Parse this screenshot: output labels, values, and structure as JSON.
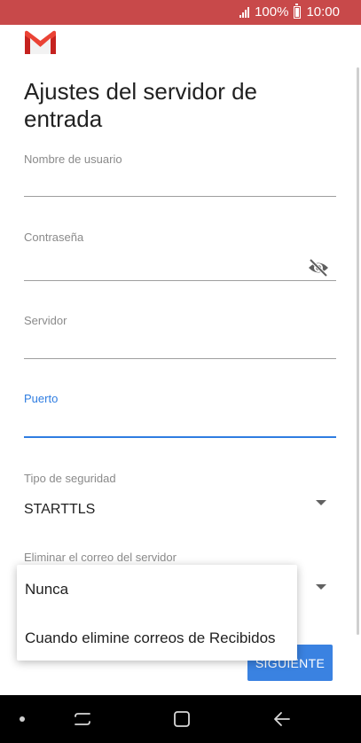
{
  "status_bar": {
    "battery": "100%",
    "time": "10:00"
  },
  "app": {
    "logo": "gmail-logo",
    "title": "Ajustes del servidor de entrada"
  },
  "form": {
    "username": {
      "label": "Nombre de usuario",
      "value": ""
    },
    "password": {
      "label": "Contraseña",
      "value": "",
      "toggle_icon": "visibility-off-icon"
    },
    "server": {
      "label": "Servidor",
      "value": ""
    },
    "port": {
      "label": "Puerto",
      "value": "",
      "focused": true
    },
    "security_type": {
      "label": "Tipo de seguridad",
      "value": "STARTTLS"
    },
    "delete_from_server": {
      "label": "Eliminar el correo del servidor"
    }
  },
  "popup_menu": {
    "items": [
      "Nunca",
      "Cuando elimine correos de Recibidos"
    ]
  },
  "next_button": {
    "label": "SIGUIENTE"
  },
  "nav_bar": {
    "icons": [
      "recent-apps-icon",
      "home-icon",
      "back-icon"
    ]
  },
  "colors": {
    "status_bar": "#c8494a",
    "accent": "#2f7de1",
    "button": "#3a82e1"
  }
}
